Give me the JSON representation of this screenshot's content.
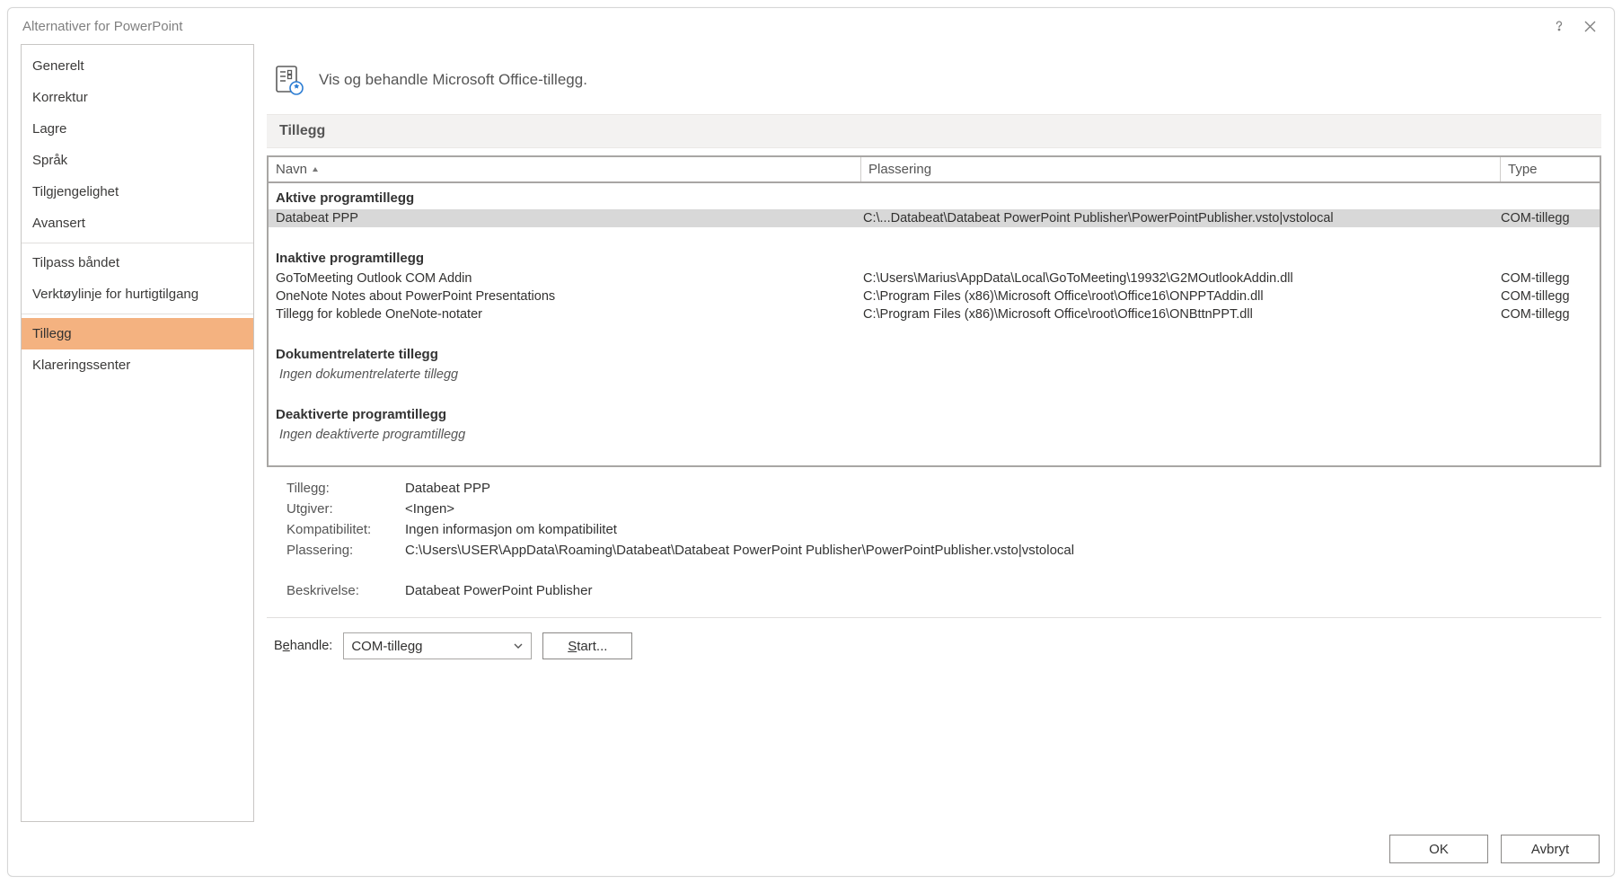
{
  "window": {
    "title": "Alternativer for PowerPoint"
  },
  "sidebar": {
    "groups": [
      [
        "Generelt",
        "Korrektur",
        "Lagre",
        "Språk",
        "Tilgjengelighet",
        "Avansert"
      ],
      [
        "Tilpass båndet",
        "Verktøylinje for hurtigtilgang"
      ],
      [
        "Tillegg",
        "Klareringssenter"
      ]
    ],
    "selected": "Tillegg"
  },
  "page": {
    "heading": "Vis og behandle Microsoft Office-tillegg.",
    "section_label": "Tillegg",
    "columns": {
      "name": "Navn",
      "location": "Plassering",
      "type": "Type"
    },
    "groups": [
      {
        "title": "Aktive programtillegg",
        "empty": null,
        "rows": [
          {
            "name": "Databeat PPP",
            "location": "C:\\...Databeat\\Databeat PowerPoint Publisher\\PowerPointPublisher.vsto|vstolocal",
            "type": "COM-tillegg",
            "selected": true
          }
        ]
      },
      {
        "title": "Inaktive programtillegg",
        "empty": null,
        "rows": [
          {
            "name": "GoToMeeting Outlook COM Addin",
            "location": "C:\\Users\\Marius\\AppData\\Local\\GoToMeeting\\19932\\G2MOutlookAddin.dll",
            "type": "COM-tillegg",
            "selected": false
          },
          {
            "name": "OneNote Notes about PowerPoint Presentations",
            "location": "C:\\Program Files (x86)\\Microsoft Office\\root\\Office16\\ONPPTAddin.dll",
            "type": "COM-tillegg",
            "selected": false
          },
          {
            "name": "Tillegg for koblede OneNote-notater",
            "location": "C:\\Program Files (x86)\\Microsoft Office\\root\\Office16\\ONBttnPPT.dll",
            "type": "COM-tillegg",
            "selected": false
          }
        ]
      },
      {
        "title": "Dokumentrelaterte tillegg",
        "empty": "Ingen dokumentrelaterte tillegg",
        "rows": []
      },
      {
        "title": "Deaktiverte programtillegg",
        "empty": "Ingen deaktiverte programtillegg",
        "rows": []
      }
    ],
    "details": {
      "labels": {
        "addin": "Tillegg:",
        "publisher": "Utgiver:",
        "compat": "Kompatibilitet:",
        "location": "Plassering:",
        "description": "Beskrivelse:"
      },
      "values": {
        "addin": "Databeat PPP",
        "publisher": "<Ingen>",
        "compat": "Ingen informasjon om kompatibilitet",
        "location": "C:\\Users\\USER\\AppData\\Roaming\\Databeat\\Databeat PowerPoint Publisher\\PowerPointPublisher.vsto|vstolocal",
        "description": "Databeat PowerPoint Publisher"
      }
    },
    "manage": {
      "label_prefix": "B",
      "label_underline": "e",
      "label_suffix": "handle:",
      "combo_value": "COM-tillegg",
      "start_underline": "S",
      "start_rest": "tart..."
    }
  },
  "footer": {
    "ok": "OK",
    "cancel": "Avbryt"
  }
}
